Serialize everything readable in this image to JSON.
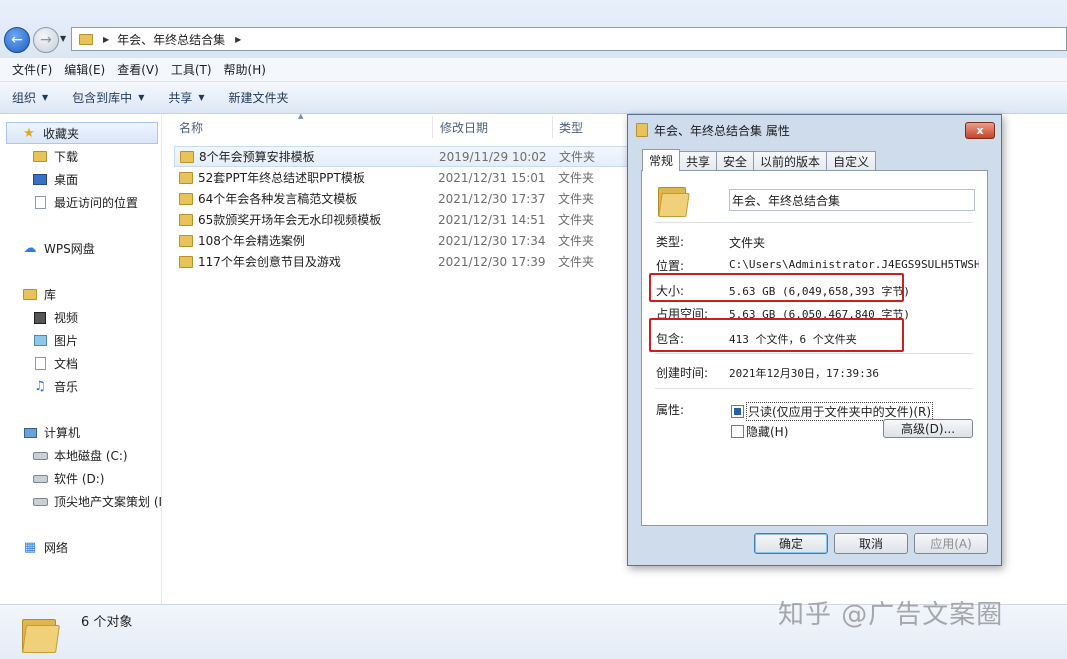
{
  "address": {
    "path": "年会、年终总结合集"
  },
  "menu": [
    "文件(F)",
    "编辑(E)",
    "查看(V)",
    "工具(T)",
    "帮助(H)"
  ],
  "toolbar": {
    "organize": "组织",
    "include_library": "包含到库中",
    "share": "共享",
    "new_folder": "新建文件夹"
  },
  "nav": {
    "favorites": "收藏夹",
    "downloads": "下载",
    "desktop": "桌面",
    "recent": "最近访问的位置",
    "wps": "WPS网盘",
    "libraries": "库",
    "videos": "视频",
    "pictures": "图片",
    "documents": "文档",
    "music": "音乐",
    "computer": "计算机",
    "drive_c": "本地磁盘 (C:)",
    "drive_d": "软件 (D:)",
    "drive_e": "顶尖地产文案策划 (I",
    "network": "网络"
  },
  "columns": {
    "name": "名称",
    "date": "修改日期",
    "type": "类型"
  },
  "files": [
    {
      "name": "8个年会预算安排模板",
      "date": "2019/11/29 10:02",
      "type": "文件夹"
    },
    {
      "name": "52套PPT年终总结述职PPT模板",
      "date": "2021/12/31 15:01",
      "type": "文件夹"
    },
    {
      "name": "64个年会各种发言稿范文模板",
      "date": "2021/12/30 17:37",
      "type": "文件夹"
    },
    {
      "name": "65款颁奖开场年会无水印视频模板",
      "date": "2021/12/31 14:51",
      "type": "文件夹"
    },
    {
      "name": "108个年会精选案例",
      "date": "2021/12/30 17:34",
      "type": "文件夹"
    },
    {
      "name": "117个年会创意节目及游戏",
      "date": "2021/12/30 17:39",
      "type": "文件夹"
    }
  ],
  "status": {
    "count": "6 个对象"
  },
  "watermark": "知乎 @广告文案圈",
  "dialog": {
    "title": "年会、年终总结合集 属性",
    "close": "x",
    "tabs": [
      "常规",
      "共享",
      "安全",
      "以前的版本",
      "自定义"
    ],
    "folder_name": "年会、年终总结合集",
    "type_label": "类型:",
    "type_value": "文件夹",
    "location_label": "位置:",
    "location_value": "C:\\Users\\Administrator.J4EGS9SULH5TWSH\\De",
    "size_label": "大小:",
    "size_value": "5.63 GB (6,049,658,393 字节)",
    "disk_label": "占用空间:",
    "disk_value": "5.63 GB (6,050,467,840 字节)",
    "contains_label": "包含:",
    "contains_value": "413 个文件，6 个文件夹",
    "created_label": "创建时间:",
    "created_value": "2021年12月30日，17:39:36",
    "attr_label": "属性:",
    "readonly": "只读(仅应用于文件夹中的文件)(R)",
    "hidden": "隐藏(H)",
    "advanced": "高级(D)...",
    "ok": "确定",
    "cancel": "取消",
    "apply": "应用(A)"
  }
}
